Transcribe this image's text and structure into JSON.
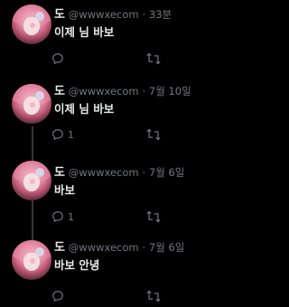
{
  "tweets": [
    {
      "name": "도",
      "handle": "@wwwxecom",
      "separator": "·",
      "time": "33분",
      "text": "이제 님 바보",
      "reply_count": "",
      "icons": {
        "reply": "reply-icon",
        "retweet": "retweet-icon"
      }
    },
    {
      "name": "도",
      "handle": "@wwwxecom",
      "separator": "·",
      "time": "7월 10일",
      "text": "이제 님 바보",
      "reply_count": "1",
      "icons": {
        "reply": "reply-icon",
        "retweet": "retweet-icon"
      }
    },
    {
      "name": "도",
      "handle": "@wwwxecom",
      "separator": "·",
      "time": "7월 6일",
      "text": "바보",
      "reply_count": "1",
      "icons": {
        "reply": "reply-icon",
        "retweet": "retweet-icon"
      }
    },
    {
      "name": "도",
      "handle": "@wwwxecom",
      "separator": "·",
      "time": "7월 6일",
      "text": "바보 안녕",
      "reply_count": "",
      "icons": {
        "reply": "reply-icon",
        "retweet": "retweet-icon"
      }
    }
  ],
  "colors": {
    "background": "#000000",
    "text_primary": "#e7e9ea",
    "text_secondary": "#71767b",
    "thread_line": "#333639"
  }
}
